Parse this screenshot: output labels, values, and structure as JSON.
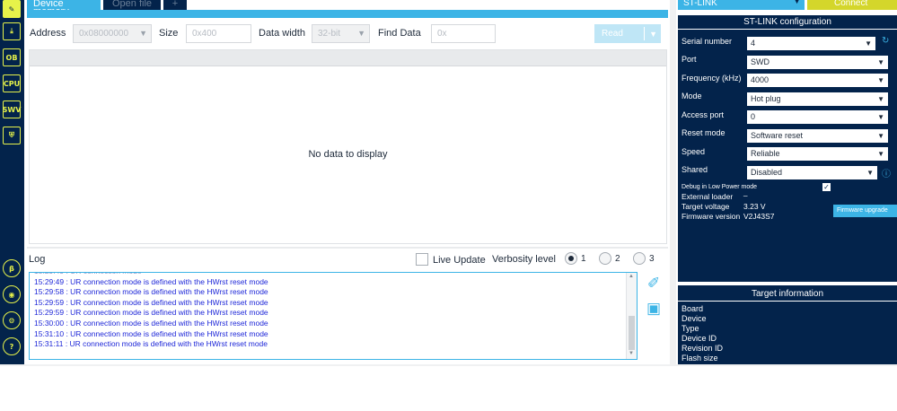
{
  "tabs": {
    "device_memory": "Device memory",
    "open_file": "Open file",
    "add": "+"
  },
  "memory_toolbar": {
    "address_label": "Address",
    "address_value": "0x08000000",
    "size_label": "Size",
    "size_placeholder": "0x400",
    "width_label": "Data width",
    "width_value": "32-bit",
    "find_label": "Find Data",
    "find_placeholder": "0x",
    "read_label": "Read"
  },
  "grid": {
    "empty_text": "No data to display"
  },
  "log": {
    "title": "Log",
    "live_update_label": "Live Update",
    "verbosity_label": "Verbosity level",
    "verbosity_options": [
      "1",
      "2",
      "3"
    ],
    "verbosity_selected": "1",
    "lines": [
      "15:29:49 : UR connection mode is defined with the HWrst reset mode",
      "15:29:58 : UR connection mode is defined with the HWrst reset mode",
      "15:29:59 : UR connection mode is defined with the HWrst reset mode",
      "15:29:59 : UR connection mode is defined with the HWrst reset mode",
      "15:30:00 : UR connection mode is defined with the HWrst reset mode",
      "15:31:10 : UR connection mode is defined with the HWrst reset mode",
      "15:31:11 : UR connection mode is defined with the HWrst reset mode"
    ]
  },
  "left_toolbar": {
    "icons": [
      "edit-icon",
      "download-icon",
      "ob-icon",
      "cpu-icon",
      "swv-icon",
      "security-icon",
      "beta-icon",
      "el-icon",
      "settings-icon",
      "help-icon"
    ],
    "ob_text": "OB",
    "cpu_text": "CPU",
    "swv_text": "SWV"
  },
  "connection": {
    "interface_value": "ST-LINK",
    "connect_label": "Connect"
  },
  "stlink_config": {
    "title": "ST-LINK configuration",
    "serial_label": "Serial number",
    "serial_value": "4",
    "port_label": "Port",
    "port_value": "SWD",
    "freq_label": "Frequency (kHz)",
    "freq_value": "4000",
    "mode_label": "Mode",
    "mode_value": "Hot plug",
    "access_port_label": "Access port",
    "access_port_value": "0",
    "reset_label": "Reset mode",
    "reset_value": "Software reset",
    "speed_label": "Speed",
    "speed_value": "Reliable",
    "shared_label": "Shared",
    "shared_value": "Disabled",
    "debug_lp_label": "Debug in Low Power mode",
    "ext_loader_label": "External loader",
    "ext_loader_value": "_",
    "target_voltage_label": "Target voltage",
    "target_voltage_value": "3.23 V",
    "fw_version_label": "Firmware version",
    "fw_version_value": "V2J43S7",
    "fw_upgrade_label": "Firmware upgrade"
  },
  "target_info": {
    "title": "Target information",
    "labels": [
      "Board",
      "Device",
      "Type",
      "Device ID",
      "Revision ID",
      "Flash size"
    ]
  },
  "colors": {
    "navy": "#03234b",
    "accent_blue": "#3cb4e6",
    "accent_yellow": "#e6f24a",
    "connect_green": "#d4d62b",
    "log_text": "#1e27d8"
  }
}
